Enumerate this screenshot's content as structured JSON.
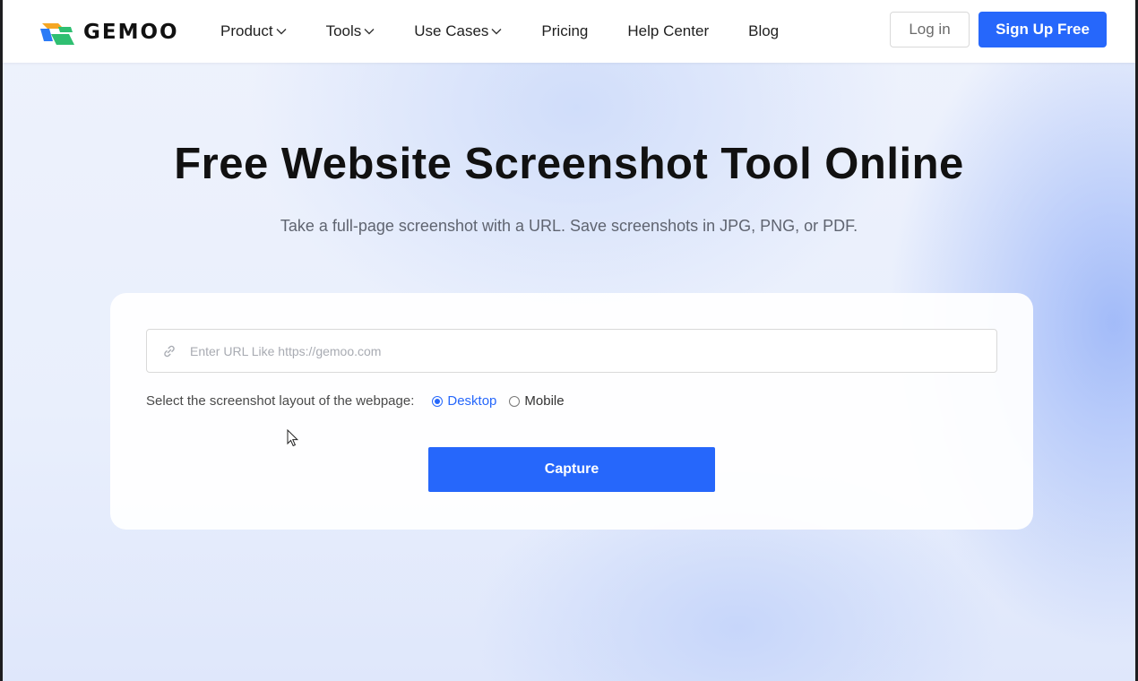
{
  "header": {
    "logo_text": "GEMOO",
    "nav": [
      {
        "label": "Product",
        "has_dropdown": true
      },
      {
        "label": "Tools",
        "has_dropdown": true
      },
      {
        "label": "Use Cases",
        "has_dropdown": true
      },
      {
        "label": "Pricing",
        "has_dropdown": false
      },
      {
        "label": "Help Center",
        "has_dropdown": false
      },
      {
        "label": "Blog",
        "has_dropdown": false
      }
    ],
    "login_label": "Log in",
    "signup_label": "Sign Up Free"
  },
  "hero": {
    "title": "Free Website Screenshot Tool Online",
    "subtitle": "Take a full-page screenshot with a URL. Save screenshots in JPG, PNG, or PDF."
  },
  "tool": {
    "url_placeholder": "Enter URL Like https://gemoo.com",
    "url_value": "",
    "layout_label": "Select the screenshot layout of the webpage:",
    "layout_options": [
      {
        "label": "Desktop",
        "checked": true
      },
      {
        "label": "Mobile",
        "checked": false
      }
    ],
    "capture_label": "Capture"
  },
  "icons": {
    "logo": "gemoo-logo-icon",
    "link": "link-icon",
    "dropdown": "chevron-down-icon",
    "cursor": "mouse-cursor-icon"
  },
  "colors": {
    "accent": "#2667fb",
    "text": "#111111",
    "muted": "#5f6470",
    "logo_orange": "#f5a623",
    "logo_green": "#2fbf71",
    "logo_blue": "#2b7bf6"
  }
}
